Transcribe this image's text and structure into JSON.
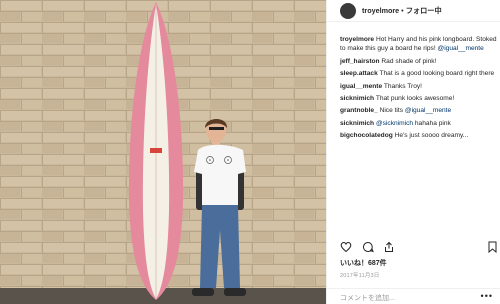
{
  "post": {
    "username": "troyelmore",
    "separator": "•",
    "follow_label": "フォロー中"
  },
  "comments": [
    {
      "user": "troyelmore",
      "text": "Hot Harry and his pink longboard. Stoked to make this guy a board he rips!",
      "mention": "@igual__mente"
    },
    {
      "user": "jeff_hairston",
      "text": "Rad shade of pink!",
      "mention": ""
    },
    {
      "user": "sleep.attack",
      "text": "That is a good looking board right there",
      "mention": ""
    },
    {
      "user": "igual__mente",
      "text": "Thanks Troy!",
      "mention": ""
    },
    {
      "user": "sicknimich",
      "text": "That punk looks awesome!",
      "mention": ""
    },
    {
      "user": "grantnoble_",
      "text": "Nice tits",
      "mention": "@igual__mente"
    },
    {
      "user": "sicknimich",
      "text": "hahaha pink",
      "mention": "@sicknimich"
    },
    {
      "user": "bigchocolatedog",
      "text": "He's just soooo dreamy...",
      "mention": ""
    }
  ],
  "actions": {
    "like_icon": "heart-icon",
    "comment_icon": "comment-icon",
    "share_icon": "share-icon",
    "save_icon": "bookmark-icon"
  },
  "likes_label": "いいね！687件",
  "date_label": "2017年11月3日",
  "add_comment_placeholder": "コメントを追加...",
  "more_label": "•••",
  "colors": {
    "brick": "#c9b79a",
    "board_pink": "#e8899c",
    "board_white": "#f3efe6",
    "ground": "#5a534b",
    "text": "#262626",
    "mention": "#003569"
  }
}
